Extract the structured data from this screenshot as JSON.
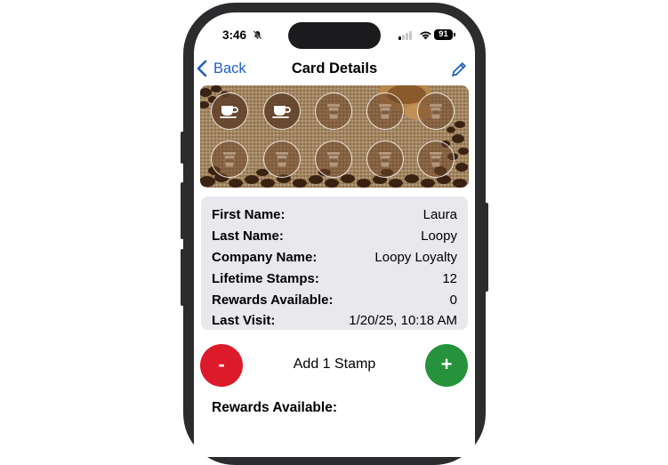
{
  "status_bar": {
    "time": "3:46",
    "battery": "91"
  },
  "nav": {
    "back_label": "Back",
    "title": "Card Details"
  },
  "stamp_card": {
    "total_slots": 10,
    "filled_stamps": 2
  },
  "details": [
    {
      "label": "First Name:",
      "value": "Laura"
    },
    {
      "label": "Last Name:",
      "value": "Loopy"
    },
    {
      "label": "Company Name:",
      "value": "Loopy Loyalty"
    },
    {
      "label": "Lifetime Stamps:",
      "value": "12"
    },
    {
      "label": "Rewards Available:",
      "value": "0"
    },
    {
      "label": "Last Visit:",
      "value": "1/20/25, 10:18 AM"
    }
  ],
  "stamp_control": {
    "minus_label": "-",
    "plus_label": "+",
    "label": "Add 1 Stamp"
  },
  "rewards_section": {
    "label": "Rewards Available:"
  },
  "colors": {
    "accent": "#1f5fbf",
    "minus": "#dc1a2a",
    "plus": "#26933c",
    "panel": "#e8e8ed"
  }
}
